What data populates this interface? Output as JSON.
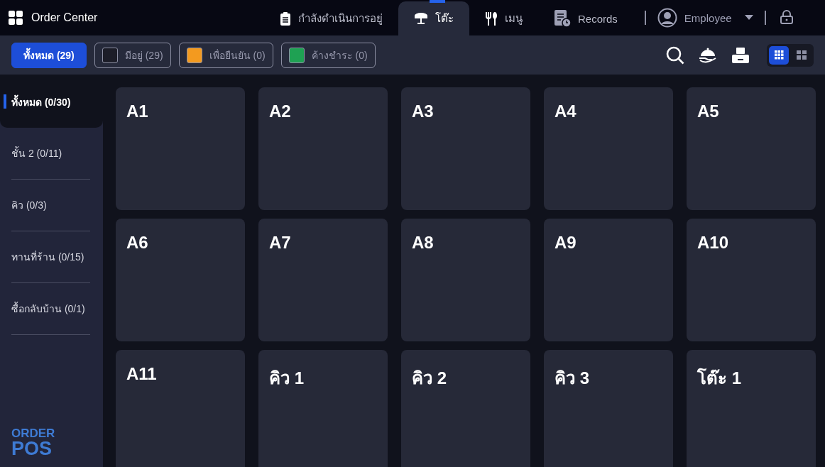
{
  "app": {
    "title": "Order Center"
  },
  "nav_tabs": [
    {
      "label": "กำลังดำเนินการอยู่",
      "kind": "clipboard",
      "selected": false
    },
    {
      "label": "โต๊ะ",
      "kind": "table",
      "selected": true
    },
    {
      "label": "เมนู",
      "kind": "cutlery",
      "selected": false
    },
    {
      "label": "Records",
      "kind": "records",
      "selected": false
    }
  ],
  "user": {
    "name": "Employee"
  },
  "filters": [
    {
      "label": "ทั้งหมด (29)",
      "selected": true
    },
    {
      "label": "มีอยู่ (29)",
      "selected": false,
      "color": "#1c1d28"
    },
    {
      "label": "เพื่อยืนยัน (0)",
      "selected": false,
      "color": "#f39a1f"
    },
    {
      "label": "ค้างชำระ (0)",
      "selected": false,
      "color": "#1fa153"
    }
  ],
  "view_modes": [
    {
      "kind": "grid",
      "selected": true
    },
    {
      "kind": "tiles",
      "selected": false
    }
  ],
  "zones": [
    {
      "label": "ทั้งหมด (0/30)",
      "selected": true
    },
    {
      "label": "ชั้น 2 (0/11)",
      "selected": false
    },
    {
      "label": "คิว (0/3)",
      "selected": false
    },
    {
      "label": "ทานที่ร้าน (0/15)",
      "selected": false
    },
    {
      "label": "ซื้อกลับบ้าน (0/1)",
      "selected": false
    }
  ],
  "tables": [
    "A1",
    "A2",
    "A3",
    "A4",
    "A5",
    "A6",
    "A7",
    "A8",
    "A9",
    "A10",
    "A11",
    "คิว 1",
    "คิว 2",
    "คิว 3",
    "โต๊ะ 1"
  ],
  "brand": {
    "line_1": "ORDER",
    "line_2": "POS"
  }
}
